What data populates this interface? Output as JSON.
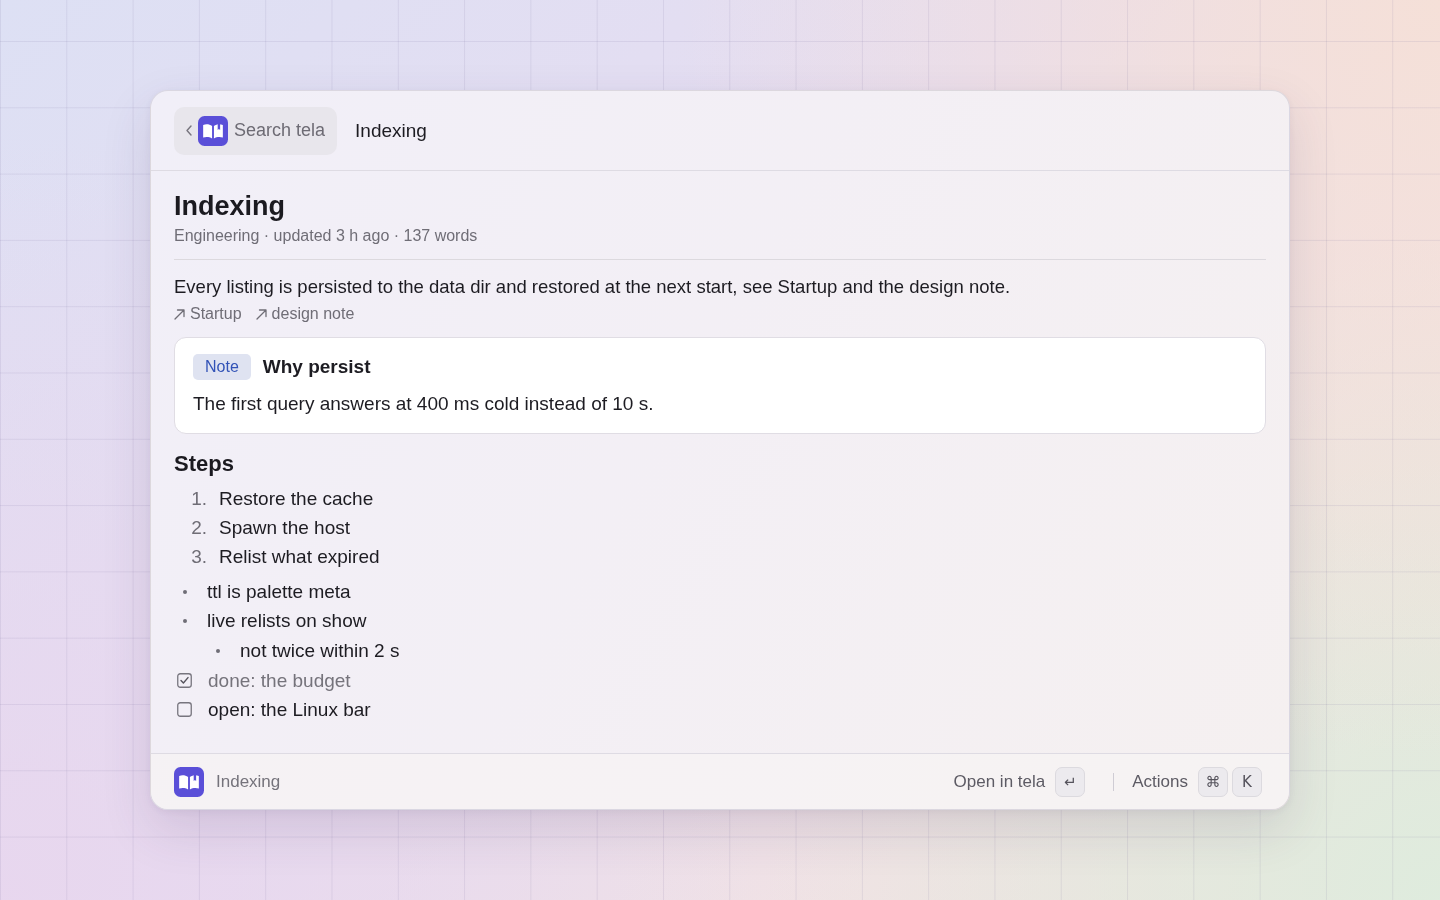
{
  "header": {
    "back_button": {
      "label": "Search tela"
    },
    "title": "Indexing"
  },
  "document": {
    "title": "Indexing",
    "meta": "Engineering · updated 3 h ago · 137 words",
    "paragraph": "Every listing is persisted to the data dir and restored at the next start, see Startup and the design note.",
    "links": [
      {
        "label": "Startup"
      },
      {
        "label": "design note"
      }
    ],
    "callout": {
      "tag": "Note",
      "title": "Why persist",
      "text": "The first query answers at 400 ms cold instead of 10 s."
    },
    "section_heading": "Steps",
    "ordered_list": [
      {
        "number": "1.",
        "text": "Restore the cache"
      },
      {
        "number": "2.",
        "text": "Spawn the host"
      },
      {
        "number": "3.",
        "text": "Relist what expired"
      }
    ],
    "bullets": [
      {
        "text": "ttl is palette meta"
      },
      {
        "text": "live relists on show",
        "children": [
          {
            "text": "not twice within 2 s"
          }
        ]
      }
    ],
    "tasks": [
      {
        "text": "done: the budget",
        "checked": true
      },
      {
        "text": "open: the Linux bar",
        "checked": false
      }
    ]
  },
  "footer": {
    "label": "Indexing",
    "actions": [
      {
        "label": "Open in tela",
        "keys": [
          "↵"
        ]
      },
      {
        "label": "Actions",
        "keys": [
          "⌘",
          "K"
        ]
      }
    ]
  }
}
